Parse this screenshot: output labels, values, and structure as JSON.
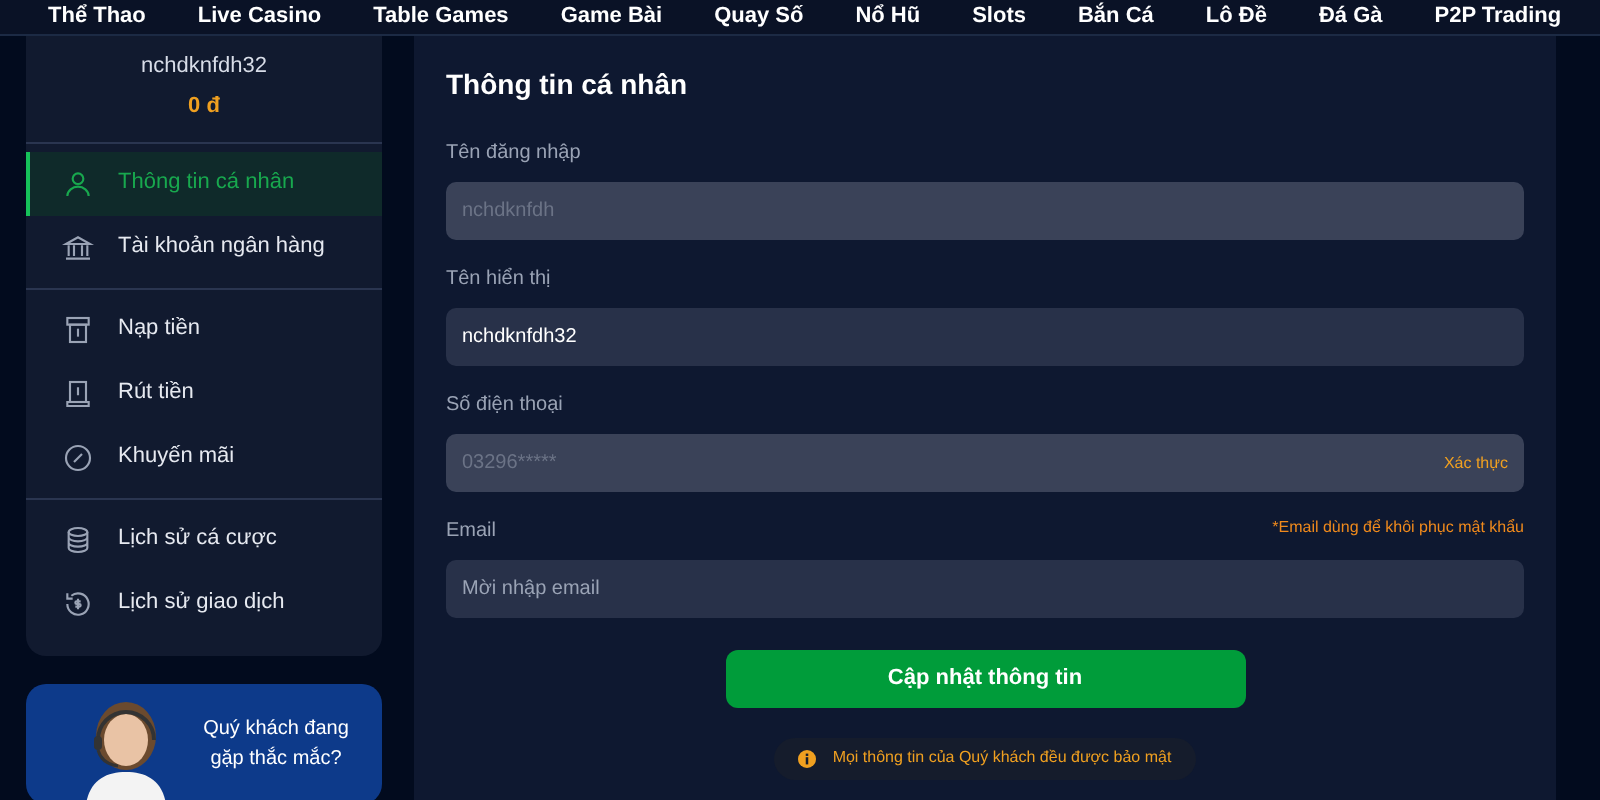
{
  "nav": {
    "items": [
      {
        "label": "Thể Thao"
      },
      {
        "label": "Live Casino"
      },
      {
        "label": "Table Games"
      },
      {
        "label": "Game Bài"
      },
      {
        "label": "Quay Số"
      },
      {
        "label": "Nổ Hũ"
      },
      {
        "label": "Slots"
      },
      {
        "label": "Bắn Cá"
      },
      {
        "label": "Lô Đề"
      },
      {
        "label": "Đá Gà"
      },
      {
        "label": "P2P Trading"
      }
    ]
  },
  "account": {
    "username": "nchdknfdh32",
    "balance": "0 đ"
  },
  "sidebar": {
    "groups": [
      [
        {
          "label": "Thông tin cá nhân",
          "kind": "user",
          "selected": true
        },
        {
          "label": "Tài khoản ngân hàng",
          "kind": "bank",
          "selected": false
        }
      ],
      [
        {
          "label": "Nạp tiền",
          "kind": "deposit",
          "selected": false
        },
        {
          "label": "Rút tiền",
          "kind": "withdraw",
          "selected": false
        },
        {
          "label": "Khuyến mãi",
          "kind": "promo",
          "selected": false
        }
      ],
      [
        {
          "label": "Lịch sử cá cược",
          "kind": "coins",
          "selected": false
        },
        {
          "label": "Lịch sử giao dịch",
          "kind": "history",
          "selected": false
        }
      ]
    ]
  },
  "support": {
    "text": "Quý khách đang gặp thắc mắc?"
  },
  "form": {
    "title": "Thông tin cá nhân",
    "fields": [
      {
        "label": "Tên đăng nhập",
        "value": "nchdknfdh",
        "disabled": true
      },
      {
        "label": "Tên hiển thị",
        "value": "nchdknfdh32",
        "disabled": false
      },
      {
        "label": "Số điện thoại",
        "value": "03296*****",
        "disabled": true,
        "action": "Xác thực"
      },
      {
        "label": "Email",
        "placeholder": "Mời nhập email",
        "disabled": false,
        "note": "*Email dùng để khôi phục mật khẩu"
      }
    ],
    "submit": "Cập nhật thông tin",
    "notice": "Mọi thông tin của Quý khách đều được bảo mật"
  }
}
